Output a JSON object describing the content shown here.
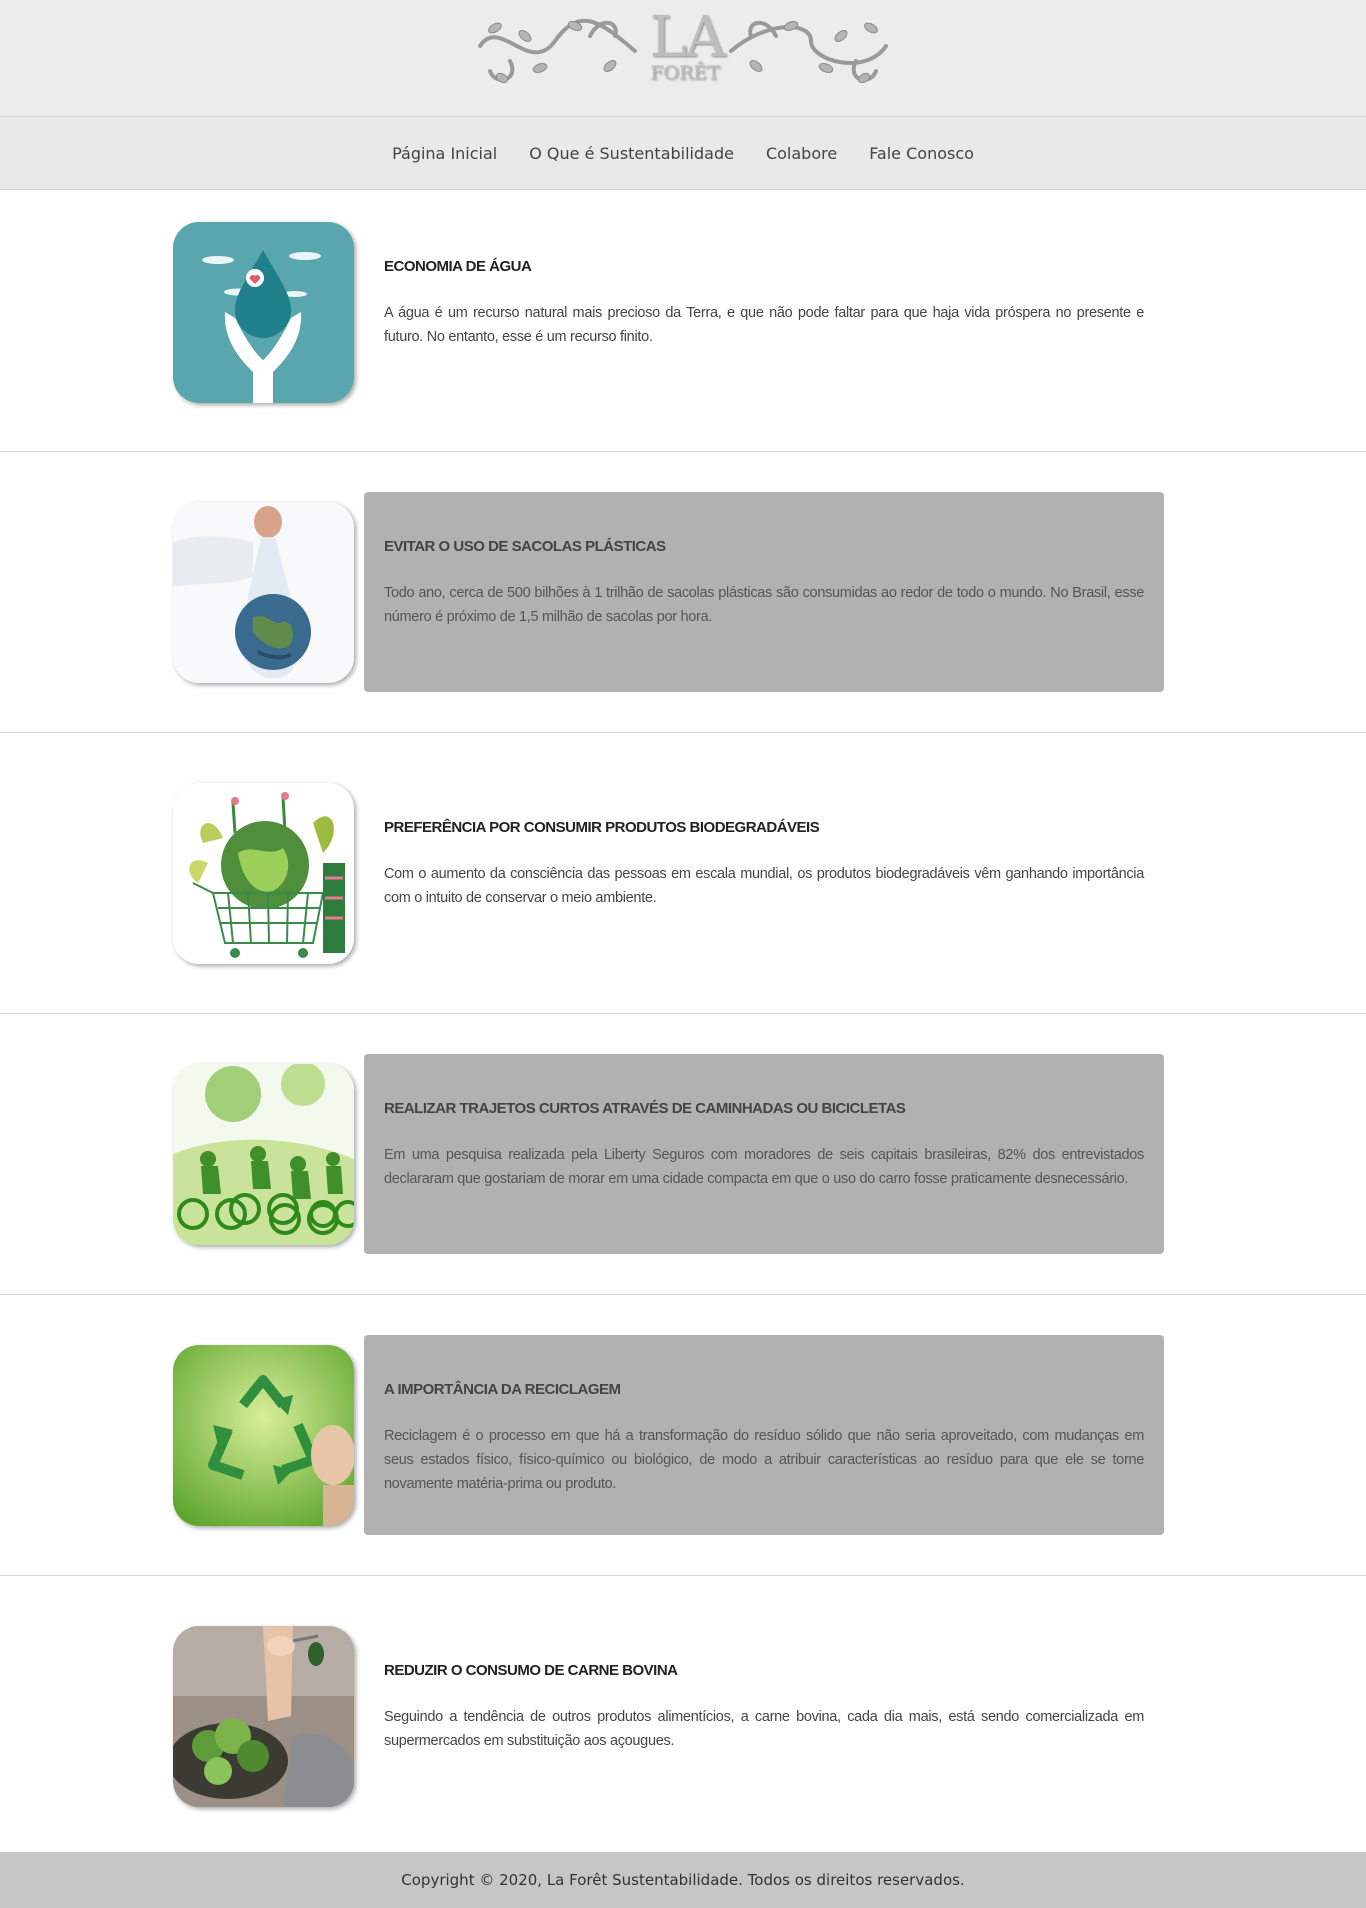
{
  "header": {
    "logo_la": "LA",
    "logo_foret": "FORÊT"
  },
  "nav": {
    "items": [
      "Página Inicial",
      "O Que é Sustentabilidade",
      "Colabore",
      "Fale Conosco"
    ]
  },
  "sections": [
    {
      "title": "ECONOMIA DE ÁGUA",
      "text": "A água é um recurso natural mais precioso da Terra, e que não pode faltar para que haja vida próspera no presente e futuro. No entanto, esse é um recurso finito.",
      "highlight": false,
      "image": "water-drop-hands-icon"
    },
    {
      "title": "EVITAR O USO DE SACOLAS PLÁSTICAS",
      "text": "Todo ano, cerca de 500 bilhões à 1 trilhão de sacolas plásticas são consumidas ao redor de todo o mundo. No Brasil, esse número é próximo de 1,5 milhão de sacolas por hora.",
      "highlight": true,
      "image": "earth-in-plastic-bag-image"
    },
    {
      "title": "PREFERÊNCIA POR CONSUMIR PRODUTOS BIODEGRADÁVEIS",
      "text": "Com o aumento da consciência das pessoas em escala mundial, os produtos biodegradáveis vêm ganhando importância com o intuito de conservar o meio ambiente.",
      "highlight": false,
      "image": "globe-shopping-cart-image"
    },
    {
      "title": "REALIZAR TRAJETOS CURTOS ATRAVÉS DE CAMINHADAS OU BICICLETAS",
      "text": "Em uma pesquisa realizada pela Liberty Seguros com moradores de seis capitais brasileiras, 82% dos entrevistados declararam que gostariam de morar em uma cidade compacta em que o uso do carro fosse praticamente desnecessário.",
      "highlight": true,
      "image": "cyclists-green-image"
    },
    {
      "title": "A IMPORTÂNCIA DA RECICLAGEM",
      "text": "Reciclagem é o processo em que há a transformação do resíduo sólido que não seria aproveitado, com mudanças em seus estados físico, físico-químico ou biológico, de modo a atribuir características ao resíduo para que ele se torne novamente matéria-prima ou produto.",
      "highlight": true,
      "image": "recycle-symbol-image"
    },
    {
      "title": "REDUZIR O CONSUMO DE CARNE BOVINA",
      "text": "Seguindo a tendência de outros produtos alimentícios, a carne bovina, cada dia mais, está sendo comercializada em supermercados em substituição aos açougues.",
      "highlight": false,
      "image": "salad-eating-image"
    }
  ],
  "footer": {
    "copyright": "Copyright © 2020, La Forêt Sustentabilidade. Todos os direitos reservados."
  }
}
